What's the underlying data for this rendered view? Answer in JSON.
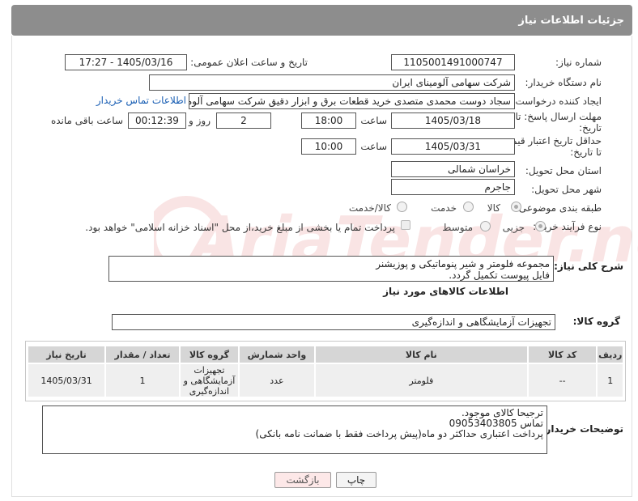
{
  "header": {
    "title": "جزئیات اطلاعات نیاز"
  },
  "form": {
    "need_number_label": "شماره نیاز:",
    "need_number": "1105001491000747",
    "announce_label": "تاریخ و ساعت اعلان عمومی:",
    "announce_value": "1405/03/16 - 17:27",
    "buyer_org_label": "نام دستگاه خریدار:",
    "buyer_org": "شرکت سهامی آلومینای ایران",
    "creator_label": "ایجاد کننده درخواست:",
    "creator": "سجاد دوست محمدی متصدی خرید قطعات برق و ابزار دقیق شرکت سهامی آلومینای ایران",
    "buyer_contact_link": "اطلاعات تماس خریدار",
    "deadline_label_1": "مهلت ارسال پاسخ: تا",
    "deadline_label_2": "تاریخ:",
    "deadline_date": "1405/03/18",
    "hour_label": "ساعت",
    "deadline_time": "18:00",
    "days_value": "2",
    "day_label": "روز و",
    "remaining_time": "00:12:39",
    "remaining_label": "ساعت باقی مانده",
    "price_valid_label_1": "حداقل تاریخ اعتبار قیمت:",
    "price_valid_label_2": "تا تاریخ:",
    "price_valid_date": "1405/03/31",
    "price_valid_time": "10:00",
    "province_label": "استان محل تحویل:",
    "province": "خراسان شمالی",
    "city_label": "شهر محل تحویل:",
    "city": "جاجرم",
    "category_label": "طبقه بندی موضوعی:",
    "category_options": [
      "کالا",
      "خدمت",
      "کالا/خدمت"
    ],
    "process_label": "نوع فرآیند خرید :",
    "process_options": [
      "جزیی",
      "متوسط"
    ],
    "treasury_note": "پرداخت تمام یا بخشی از مبلغ خرید،از محل \"اسناد خزانه اسلامی\" خواهد بود."
  },
  "general_desc": {
    "label": "شرح کلی نیاز:",
    "line1": "مجموعه فلومتر و شیر پنوماتیکی و پوزیشنر",
    "line2": "فایل پیوست تکمیل گردد."
  },
  "goods_section": {
    "title": "اطلاعات کالاهای مورد نیاز",
    "group_label": "گروه کالا:",
    "group_value": "تجهیزات آزمایشگاهی و اندازه‌گیری"
  },
  "table": {
    "headers": [
      "ردیف",
      "کد کالا",
      "نام کالا",
      "واحد شمارش",
      "گروه کالا",
      "تعداد / مقدار",
      "تاریخ نیاز"
    ],
    "row": {
      "index": "1",
      "code": "--",
      "name": "فلومتر",
      "unit": "عدد",
      "group_line1": "تجهیزات",
      "group_line2": "آزمایشگاهی و",
      "group_line3": "اندازه‌گیری",
      "qty": "1",
      "date": "1405/03/31"
    }
  },
  "buyer_notes": {
    "label": "توضیحات خریدار:",
    "line1": "ترجیحا کالای موجود.",
    "line2": "تماس 09053403805",
    "line3": "پرداخت اعتباری حداکثر دو ماه(پیش پرداخت فقط با ضمانت نامه بانکی)"
  },
  "buttons": {
    "print": "چاپ",
    "back": "بازگشت"
  },
  "watermark_text": "AriaTender.neT",
  "colors": {
    "header_bg": "#8d8d8d",
    "table_header_bg": "#d6d6d6",
    "back_button_bg": "#fde8e8",
    "link": "#1a5fb4"
  }
}
